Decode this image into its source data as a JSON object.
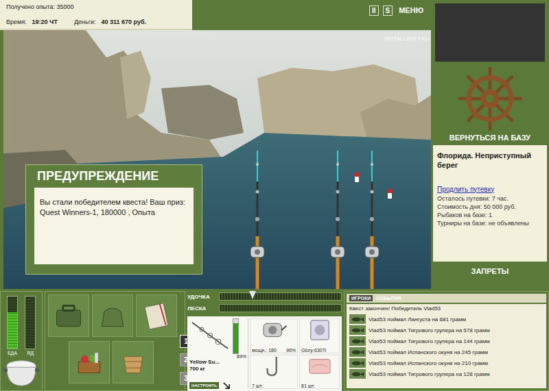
{
  "status": {
    "experience": "Получено опыта: 35000",
    "time_label": "Время:",
    "time": "19:20 ЧТ",
    "money_label": "Деньги:",
    "money": "40 311 670 руб."
  },
  "toolbar": [
    "II",
    "S",
    "МЕНЮ"
  ],
  "watermark": "INSTALLSOFT.RU",
  "rods": [
    {
      "bobber": false
    },
    {
      "bobber": true
    },
    {
      "bobber": true
    }
  ],
  "dialog": {
    "title": "ПРЕДУПРЕЖДЕНИЕ",
    "message": "Вы стали победителем квеста! Ваш приз: Quest Winners-1, 180000 , Опыта"
  },
  "sidebar": {
    "return_button": "ВЕРНУТЬСЯ НА БАЗУ",
    "location": "Флорида. Неприступный берег",
    "extend_link": "Продлить путевку",
    "info": [
      "Осталось путевки: 7 час.",
      "Стоимость дня: 50 000 руб.",
      "Рыбаков на базе: 1",
      "Турниры на базе: не объявлены"
    ],
    "bans_button": "ЗАПРЕТЫ"
  },
  "needs": [
    {
      "label": "ЕДА",
      "level": 0.7
    },
    {
      "label": "ЯД",
      "level": 0
    }
  ],
  "slots": [
    {
      "label": "1",
      "selected": true
    },
    {
      "label": "2",
      "selected": false
    },
    {
      "label": "3",
      "selected": false
    }
  ],
  "gauges": [
    {
      "label": "УДОЧКА",
      "level": 0.27
    },
    {
      "label": "ЛЕСКА",
      "level": 0
    }
  ],
  "tackle": {
    "rod": {
      "name": "Yellow Su...",
      "load": "700 кг",
      "wear": "89%",
      "level": 0.89,
      "button": "НАСТРОИТЬ"
    },
    "reel": {
      "power": "мощн.: 180",
      "wear": "96%"
    },
    "line": {
      "name": "Glory-630Ti"
    },
    "hook": {
      "count": "7 шт."
    },
    "bait": {
      "count": "81 шт."
    }
  },
  "log": {
    "tabs": [
      {
        "label": "ИГРОКИ",
        "selected": true
      },
      {
        "label": "СОБЫТИЯ",
        "selected": false
      }
    ],
    "header": "Квест закончен! Победитель Vlad53",
    "entries": [
      "Vlad53 поймал Лангуста на 681 грамм",
      "Vlad53 поймал Тигрового групера на 578 грамм",
      "Vlad53 поймал Тигрового групера на 144 грамм",
      "Vlad53 поймал Испанского окуня на 245 грамм",
      "Vlad53 поймал Испанского окуня на 210 грамм",
      "Vlad53 поймал Тигрового групера на 128 грамм"
    ]
  }
}
